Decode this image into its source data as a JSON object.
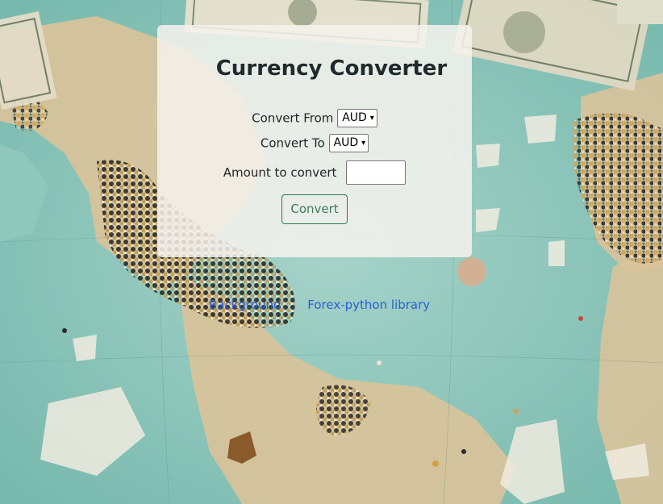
{
  "converter": {
    "title": "Currency Converter",
    "convert_from_label": "Convert From",
    "convert_from_value": "AUD",
    "convert_to_label": "Convert To",
    "convert_to_value": "AUD",
    "amount_label": "Amount to convert",
    "amount_value": "",
    "convert_button": "Convert"
  },
  "footer_links": {
    "background": "Background",
    "forex": "Forex-python library"
  },
  "colors": {
    "card_bg": "#f6f2ee",
    "button_border": "#2f7a4f",
    "link": "#2660d6",
    "map_sea": "#8fc7bd",
    "map_land": "#d9c39a"
  }
}
